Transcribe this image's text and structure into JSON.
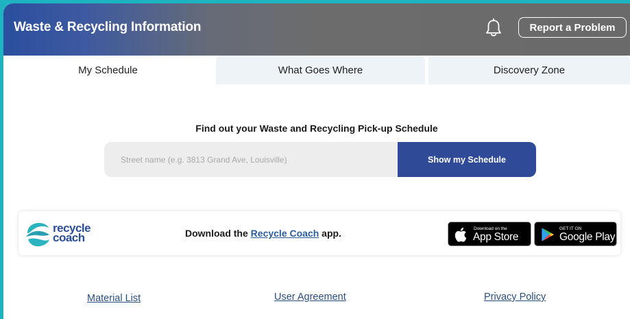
{
  "header": {
    "title": "Waste & Recycling Information",
    "report_label": "Report a Problem",
    "bell_icon": "bell-icon"
  },
  "tabs": [
    {
      "label": "My Schedule",
      "active": true
    },
    {
      "label": "What Goes Where",
      "active": false
    },
    {
      "label": "Discovery Zone",
      "active": false
    }
  ],
  "schedule": {
    "heading": "Find out your Waste and Recycling Pick-up Schedule",
    "placeholder": "Street name (e.g. 3813 Grand Ave, Louisville)",
    "button_label": "Show my Schedule"
  },
  "banner": {
    "logo_line1": "recycle",
    "logo_line2": "coach",
    "text_before": "Download the ",
    "link_text": "Recycle Coach",
    "text_after": " app.",
    "appstore_small": "Download on the",
    "appstore_big": "App Store",
    "googleplay_small": "GET IT ON",
    "googleplay_big": "Google Play"
  },
  "footer": {
    "material_list": "Material List",
    "user_agreement": "User Agreement",
    "privacy_policy": "Privacy Policy"
  },
  "colors": {
    "outer_background": "#1eb3c1",
    "header_start": "#2b4f9e",
    "header_end": "#6a6a6a",
    "button_blue": "#2f4a96",
    "tab_inactive": "#eef3f8",
    "link_color": "#2a5d9c"
  }
}
